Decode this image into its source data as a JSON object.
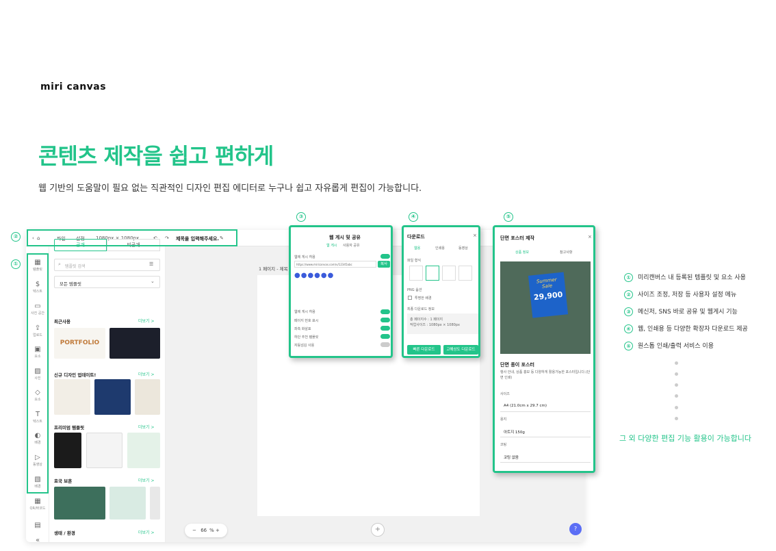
{
  "logo": "miri canvas",
  "headline": "콘텐츠 제작을 쉽고 편하게",
  "subline": "웹 기반의 도움말이 필요 없는 직관적인 디자인 편집 에디터로 누구나 쉽고 자유롭게 편집이 가능합니다.",
  "accent_color": "#23c48a",
  "markers": [
    "①",
    "②",
    "③",
    "④",
    "⑤"
  ],
  "editor": {
    "topbar": {
      "file": "파일",
      "settings": "설정",
      "size": "1080px × 1080px",
      "title_placeholder": "제목을 입력해주세요."
    },
    "rail": [
      "템플릿",
      "텍스트",
      "사진 공간",
      "업로드",
      "요소",
      "사진",
      "요소",
      "텍스트",
      "배경",
      "동영상",
      "배경",
      "QR/바코드"
    ],
    "panel": {
      "tab_public": "공개",
      "tab_private": "비공개",
      "search_placeholder": "템플릿 검색",
      "filter_value": "모든 템플릿",
      "more": "더보기 >",
      "sections": [
        "최근사용",
        "신규 디자인 업데이트!",
        "프리미엄 템플릿",
        "호국 보훈",
        "생태 / 환경"
      ],
      "recent_thumb_text": "PORTFOLIO"
    },
    "canvas": {
      "page_label": "1 페이지 - 제목",
      "zoom": "66",
      "zoom_unit": "%",
      "help": "?"
    }
  },
  "card3": {
    "title": "웹 게시 및 공유",
    "tabs": [
      "웹 게시",
      "사용자 공유"
    ],
    "url": "https://www.miricanvas.com/v/12345abc",
    "copy": "복사",
    "options": [
      "웹에 게시 허용",
      "페이지 번호 표시",
      "좌측 화살표",
      "하단 추천 템플릿",
      "자동넘김 사용"
    ]
  },
  "card4": {
    "title": "다운로드",
    "tabs": [
      "웹용",
      "인쇄용",
      "동영상"
    ],
    "file_type": "파일 형식",
    "png_option": "PNG 옵션",
    "transparent": "투명한 배경",
    "info_title": "최종 다운로드 정보",
    "info1": "총 페이지수 : 1 페이지",
    "info2": "작업사이즈 : 1080px × 1080px",
    "btn_fast": "빠른 다운로드",
    "btn_hq": "고해상도 다운로드"
  },
  "card5": {
    "title": "단면 포스터 제작",
    "tabs": [
      "상품 정보",
      "참고사항"
    ],
    "promo_summer": "Summer",
    "promo_sale": "Sale",
    "promo_price": "29,900",
    "product": "단면 종이 포스터",
    "desc": "행사 안내, 상품 홍보 등 다양하게 활용가능한 포스터입니다.(단면 인쇄)",
    "size_label": "사이즈",
    "size_value": "A4 (21.0cm x 29.7 cm)",
    "paper_label": "용지",
    "paper_value": "아트지 150g",
    "coating_label": "코팅",
    "coating_value": "코팅 없음"
  },
  "legend": [
    "미리캔버스 내 등록된 템플릿 및 요소 사용",
    "사이즈 조정, 저장 등 사용자 설정 메뉴",
    "메신저, SNS 바로 공유 및 웹게시 기능",
    "웹, 인쇄용 등 다양한 확장자 다운로드 제공",
    "원스톱 인쇄/출력 서비스 이용"
  ],
  "more_text": "그 외 다양한 편집 기능 활용이 가능합니다"
}
